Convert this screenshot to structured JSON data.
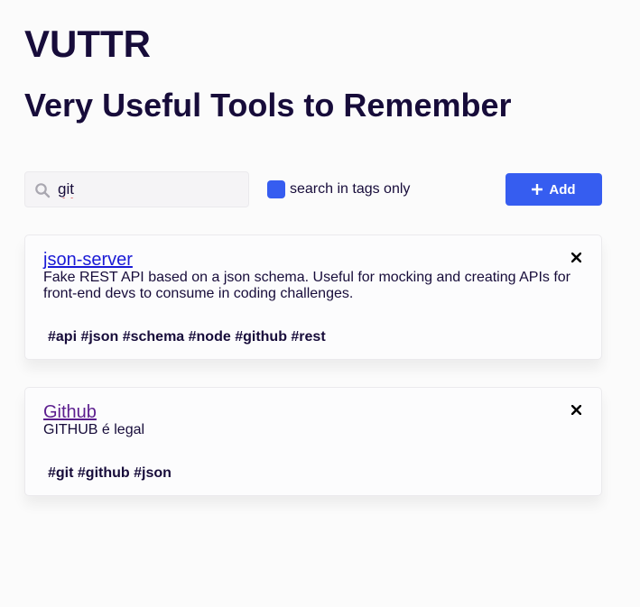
{
  "app": {
    "title": "VUTTR",
    "subtitle": "Very Useful Tools to Remember"
  },
  "search": {
    "value": "git",
    "placeholder": "",
    "icon": "search-icon"
  },
  "filter": {
    "label": "search in tags only",
    "checked": true
  },
  "add_button": {
    "label": "Add",
    "icon": "plus-icon"
  },
  "tools": [
    {
      "title": "json-server",
      "description": "Fake REST API based on a json schema. Useful for mocking and creating APIs for front-end devs to consume in coding challenges.",
      "tags": "#api #json #schema #node #github #rest"
    },
    {
      "title": "Github",
      "description": "GITHUB é legal",
      "tags": "#git #github #json"
    }
  ],
  "colors": {
    "accent": "#365df0",
    "text": "#170c3a",
    "background": "#fbfbfb",
    "link": "#1a1ad6",
    "visited_link": "#5b1d8e"
  }
}
